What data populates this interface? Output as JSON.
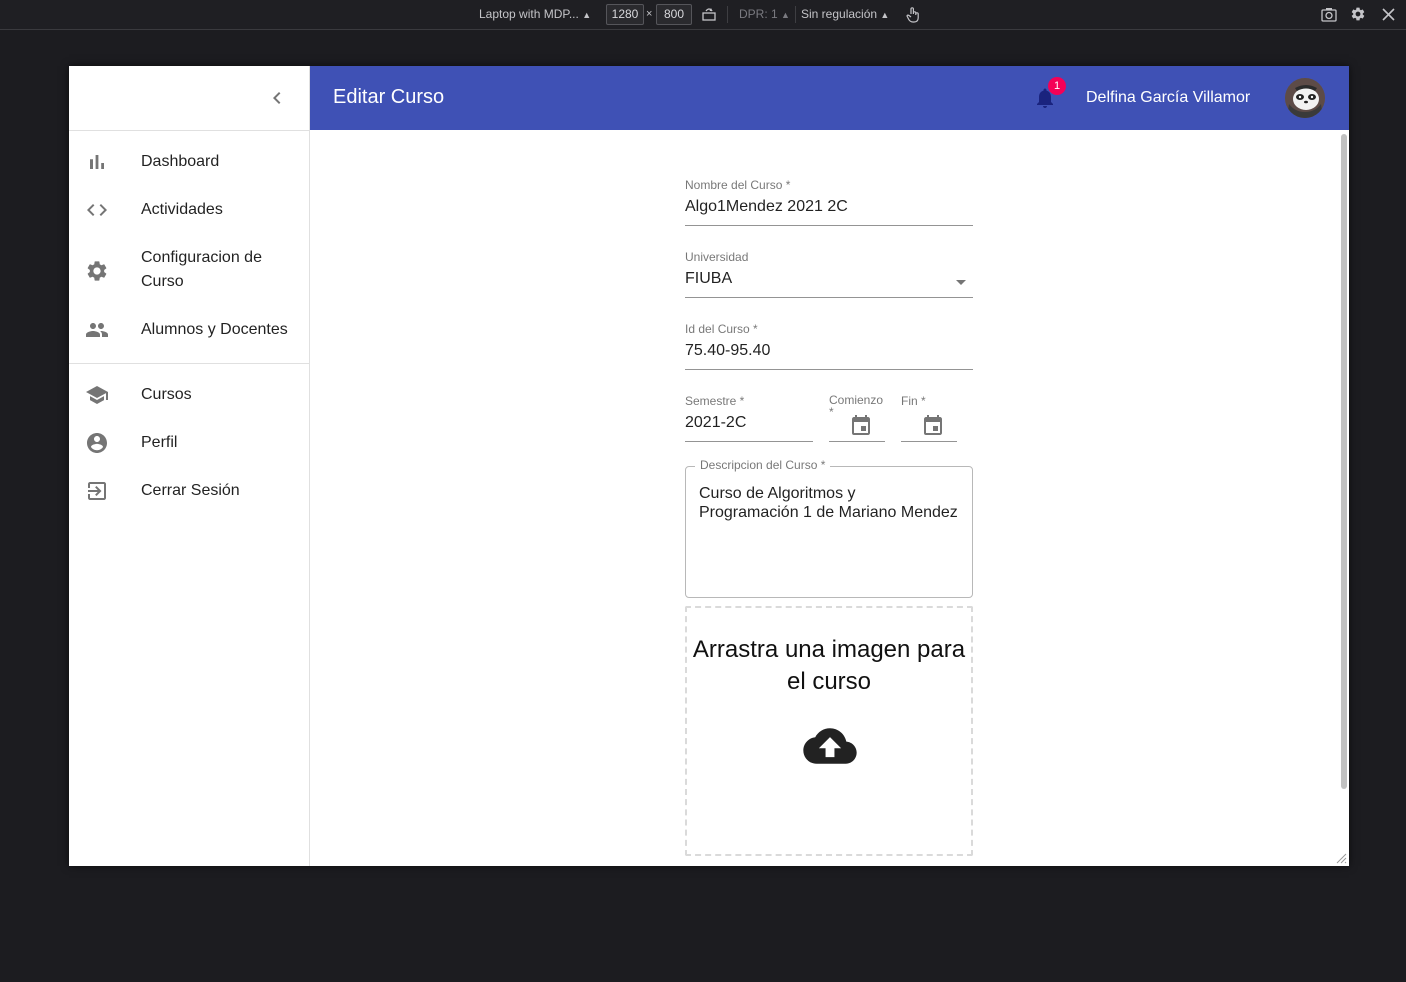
{
  "devtools": {
    "device": "Laptop with MDP...",
    "width": "1280",
    "times": "×",
    "height": "800",
    "dpr": "DPR: 1",
    "throttling": "Sin regulación"
  },
  "sidebar": {
    "group1": [
      {
        "label": "Dashboard",
        "icon": "bar-chart-icon"
      },
      {
        "label": "Actividades",
        "icon": "code-icon"
      },
      {
        "label": "Configuracion de Curso",
        "icon": "gear-icon"
      },
      {
        "label": "Alumnos y Docentes",
        "icon": "people-icon"
      }
    ],
    "group2": [
      {
        "label": "Cursos",
        "icon": "school-icon"
      },
      {
        "label": "Perfil",
        "icon": "account-circle-icon"
      },
      {
        "label": "Cerrar Sesión",
        "icon": "logout-icon"
      }
    ]
  },
  "header": {
    "title": "Editar Curso",
    "notifications": "1",
    "user_name": "Delfina García Villamor"
  },
  "form": {
    "course_name": {
      "label": "Nombre del Curso *",
      "value": "Algo1Mendez 2021 2C"
    },
    "university": {
      "label": "Universidad",
      "value": "FIUBA"
    },
    "course_id": {
      "label": "Id del Curso *",
      "value": "75.40-95.40"
    },
    "semester": {
      "label": "Semestre *",
      "value": "2021-2C"
    },
    "start": {
      "label": "Comienzo *"
    },
    "end": {
      "label": "Fin *"
    },
    "description": {
      "label": "Descripcion del Curso *",
      "value": "Curso de Algoritmos y Programación 1 de Mariano Mendez"
    },
    "dropzone_text": "Arrastra una imagen para el curso"
  },
  "colors": {
    "primary": "#3f51b5",
    "badge": "#f50057"
  }
}
